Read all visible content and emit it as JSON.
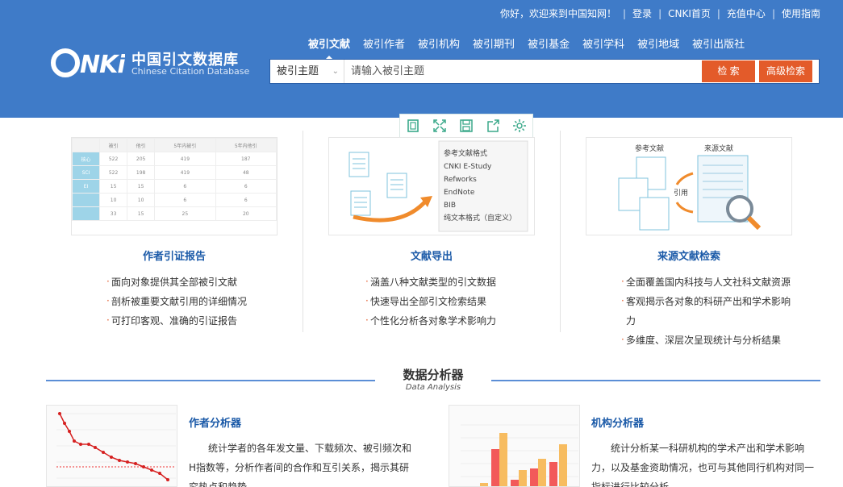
{
  "header": {
    "welcome": "你好，欢迎来到中国知网！",
    "links": [
      "登录",
      "CNKI首页",
      "充值中心",
      "使用指南"
    ],
    "logo_mark": "cnki",
    "logo_cn": "中国引文数据库",
    "logo_en": "Chinese Citation Database",
    "tabs": [
      "被引文献",
      "被引作者",
      "被引机构",
      "被引期刊",
      "被引基金",
      "被引学科",
      "被引地域",
      "被引出版社"
    ],
    "active_tab": "被引文献",
    "search": {
      "field": "被引主题",
      "placeholder": "请输入被引主题",
      "search_label": "检 索",
      "advanced_label": "高级检索"
    }
  },
  "toolbar": {
    "icons": [
      "bookmark-icon",
      "fullscreen-icon",
      "save-icon",
      "share-icon",
      "settings-icon"
    ]
  },
  "cards": [
    {
      "title": "作者引证报告",
      "features": [
        "面向对象提供其全部被引文献",
        "剖析被重要文献引用的详细情况",
        "可打印客观、准确的引证报告"
      ],
      "table": {
        "headers": [
          "",
          "被引",
          "他引",
          "5年内被引",
          "5年内他引"
        ],
        "rows": [
          [
            "核心",
            "522",
            "205",
            "419",
            "187"
          ],
          [
            "SCI",
            "522",
            "198",
            "419",
            "48"
          ],
          [
            "EI",
            "15",
            "15",
            "6",
            "6"
          ],
          [
            "",
            "10",
            "10",
            "6",
            "6"
          ],
          [
            "",
            "33",
            "15",
            "25",
            "20"
          ]
        ]
      }
    },
    {
      "title": "文献导出",
      "features": [
        "涵盖八种文献类型的引文数据",
        "快速导出全部引文检索结果",
        "个性化分析各对象学术影响力"
      ],
      "formats": [
        "参考文献格式",
        "CNKI E-Study",
        "Refworks",
        "EndNote",
        "BIB",
        "纯文本格式（自定义）"
      ]
    },
    {
      "title": "来源文献检索",
      "features": [
        "全面覆盖国内科技与人文社科文献资源",
        "客观揭示各对象的科研产出和学术影响力",
        "多维度、深层次呈现统计与分析结果"
      ],
      "diagram": {
        "left": "参考文献",
        "right": "来源文献",
        "middle": "引用"
      }
    }
  ],
  "section": {
    "title": "数据分析器",
    "subtitle": "Data Analysis"
  },
  "analyzers": [
    {
      "title": "作者分析器",
      "desc": "统计学者的各年发文量、下载频次、被引频次和H指数等，分析作者间的合作和互引关系，揭示其研究热点和趋势。"
    },
    {
      "title": "机构分析器",
      "desc": "统计分析某一科研机构的学术产出和学术影响力，以及基金资助情况，也可与其他同行机构对同一指标进行比较分析。"
    }
  ],
  "colors": {
    "header_bg": "#3f7bc8",
    "accent": "#e35b2a",
    "link": "#1b5aa8",
    "tool": "#3aa98a"
  }
}
